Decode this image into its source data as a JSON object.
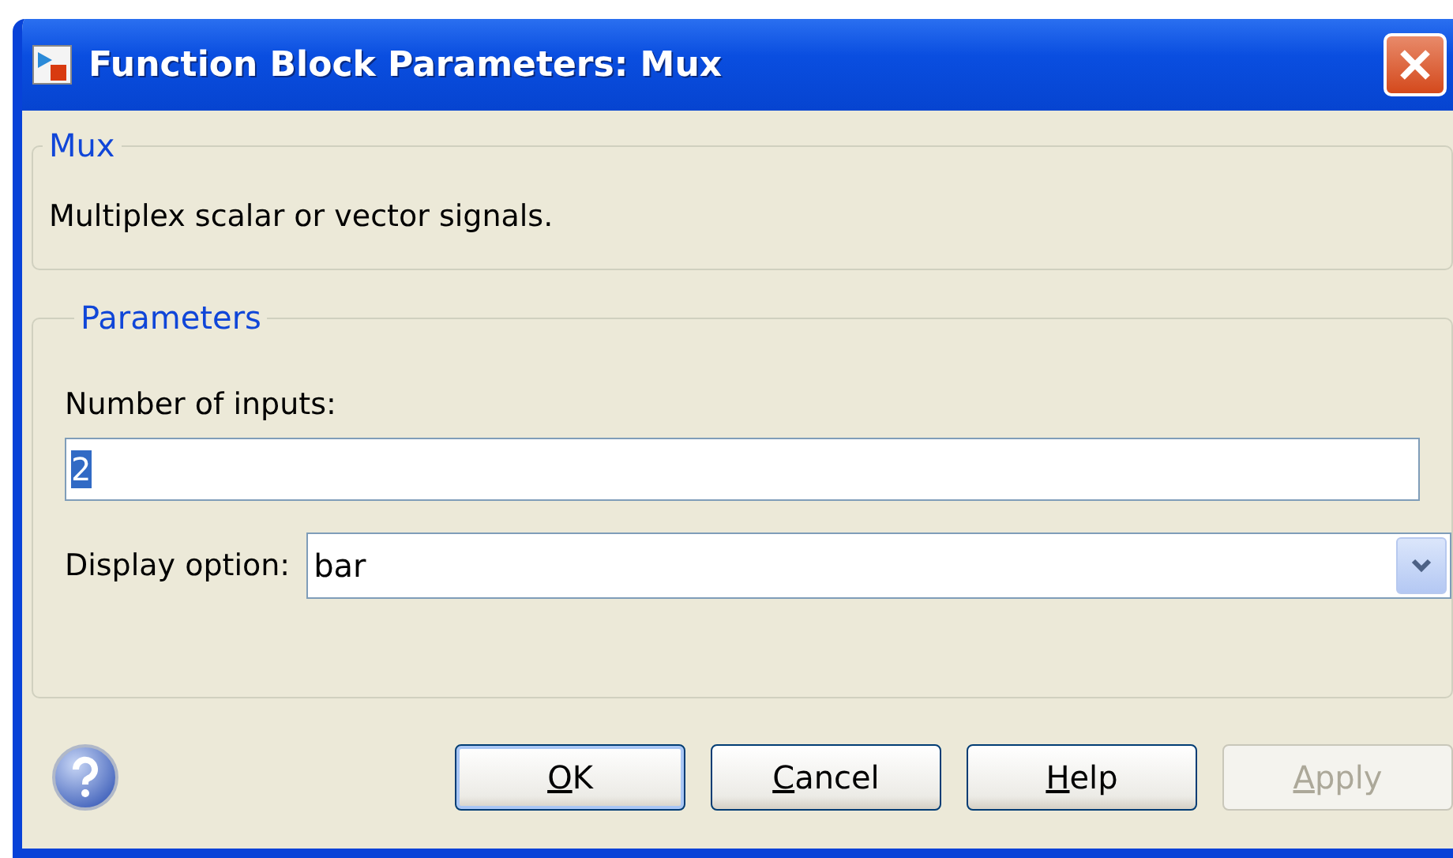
{
  "window": {
    "title": "Function Block Parameters: Mux"
  },
  "description_group": {
    "legend": "Mux",
    "text": "Multiplex scalar or vector signals."
  },
  "parameters_group": {
    "legend": "Parameters",
    "number_of_inputs": {
      "label": "Number of inputs:",
      "value": "2",
      "selected": true
    },
    "display_option": {
      "label": "Display option:",
      "value": "bar"
    }
  },
  "buttons": [
    {
      "label": "OK",
      "underline_first": true,
      "default": true,
      "disabled": false
    },
    {
      "label": "Cancel",
      "underline_first": true,
      "default": false,
      "disabled": false
    },
    {
      "label": "Help",
      "underline_first": true,
      "default": false,
      "disabled": false
    },
    {
      "label": "Apply",
      "underline_first": true,
      "default": false,
      "disabled": true
    }
  ]
}
